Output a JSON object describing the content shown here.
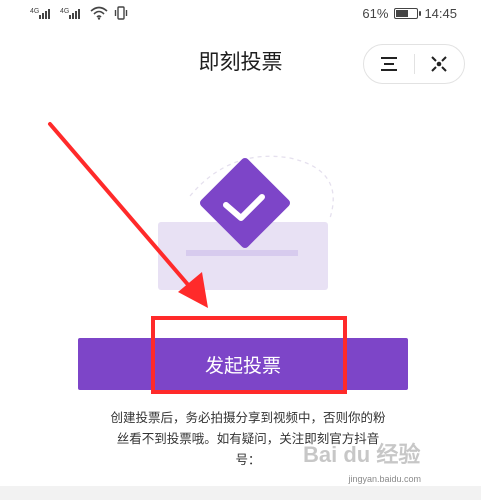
{
  "status_bar": {
    "signal1_label": "4G",
    "signal2_label": "4G",
    "battery_percent_text": "61%",
    "battery_level": 0.61,
    "time": "14:45"
  },
  "header": {
    "title": "即刻投票",
    "menu_icon": "hamburger-icon",
    "close_icon": "target-close-icon"
  },
  "main": {
    "start_vote_label": "发起投票",
    "tip": "创建投票后，务必拍摄分享到视频中，否则你的粉丝看不到投票哦。如有疑问，关注即刻官方抖音号："
  },
  "watermark": {
    "brand": "Bai du 经验",
    "url": "jingyan.baidu.com"
  },
  "colors": {
    "accent": "#7d45c8",
    "highlight": "#ff2a2a",
    "illustration_light": "#e8e1f4"
  }
}
